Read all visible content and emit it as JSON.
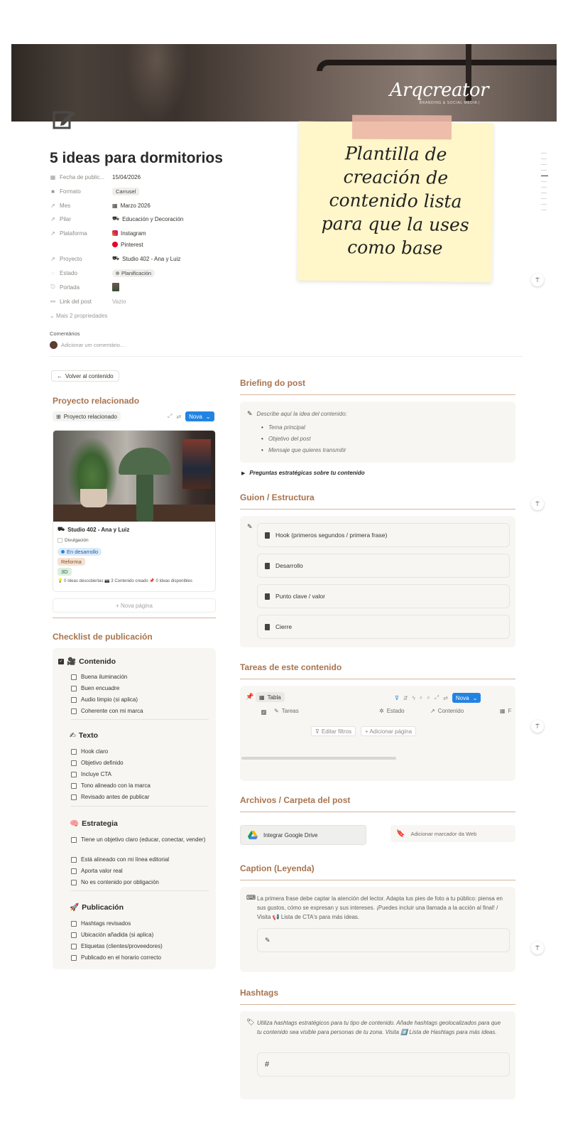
{
  "cover": {
    "brand": "Arqcreator",
    "brand_sub": "BRANDING & SOCIAL MEDIA |"
  },
  "sticky": {
    "text": "Plantilla de\ncreación de\ncontenido lista\npara que la uses\ncomo base"
  },
  "title": "5 ideas para dormitorios",
  "properties": [
    {
      "label": "Fecha de public...",
      "icon": "calendar-icon",
      "glyph": "▦",
      "value": "15/04/2026"
    },
    {
      "label": "Formato",
      "icon": "video-icon",
      "glyph": "■",
      "value": "Carrusel"
    },
    {
      "label": "Mes",
      "icon": "relation-arrow-icon",
      "glyph": "↗",
      "value": "Marzo 2026",
      "value_icon": "▦"
    },
    {
      "label": "Pilar",
      "icon": "relation-arrow-icon",
      "glyph": "↗",
      "value": "Educación y Decoración",
      "value_icon": "⛟"
    },
    {
      "label": "Plataforma",
      "icon": "relation-arrow-icon",
      "glyph": "↗",
      "value": "Instagram",
      "value2": "Pinterest"
    },
    {
      "label": "Proyecto",
      "icon": "relation-arrow-icon",
      "glyph": "↗",
      "value": "Studio 402 - Ana y Luiz",
      "value_icon": "⛟"
    },
    {
      "label": "Estado",
      "icon": "status-icon",
      "glyph": "◌",
      "value": "Planificación"
    },
    {
      "label": "Portada",
      "icon": "attachment-icon",
      "glyph": "⎋",
      "value": ""
    },
    {
      "label": "Link del post",
      "icon": "link-icon",
      "glyph": "⚯",
      "value": "Vazio"
    }
  ],
  "more_props": "Mais 2 propriedades",
  "comments": {
    "label": "Comentários",
    "placeholder": "Adicionar um comentário..."
  },
  "left": {
    "back_button": "Volver al contenido",
    "proyecto_heading": "Proyecto relacionado",
    "view_tab": "Proyecto relacionado",
    "nova_label": "Nova",
    "card": {
      "title": "Studio 402 - Ana y Luiz",
      "checkbox_label": "Divulgación",
      "status": "En desarrollo",
      "tag1": "Reforma",
      "tag2": "3D",
      "stats": "💡 0 Ideas descubiertas 📷 3 Contenido creado 📌 0 Ideas disponibles"
    },
    "nova_pagina": "+ Nova página",
    "checklist_heading": "Checklist de publicación"
  },
  "checklist": [
    {
      "head": "Contenido",
      "emoji": "🎥",
      "items": [
        "Buena iluminación",
        "Buen encuadre",
        "Audio limpio (si aplica)",
        "Coherente con mi marca"
      ]
    },
    {
      "head": "Texto",
      "emoji": "✍",
      "items": [
        "Hook claro",
        "Objetivo definido",
        "Incluye CTA",
        "Tono alineado con la marca",
        "Revisado antes de publicar"
      ]
    },
    {
      "head": "Estrategia",
      "emoji": "🧠",
      "items": [
        "Tiene un objetivo claro (educar, conectar, vender)",
        "Está alineado con mi línea editorial",
        "Aporta valor real",
        "No es contenido por obligación"
      ]
    },
    {
      "head": "Publicación",
      "emoji": "🚀",
      "items": [
        "Hashtags revisados",
        "Ubicación añadida (si aplica)",
        "Etiquetas (clientes/proveedores)",
        "Publicado en el horario correcto"
      ]
    }
  ],
  "right": {
    "briefing_heading": "Briefing do post",
    "briefing_intro": "Describe aquí la idea del contenido:",
    "briefing_bullets": [
      "Tema principal",
      "Objetivo del post",
      "Mensaje que quieres transmitir"
    ],
    "toggle": "Preguntas estratégicas sobre tu contenido",
    "guion_heading": "Guion / Estructura",
    "guion_items": [
      "Hook (primeros segundos / primera frase)",
      "Desarrollo",
      "Punto clave / valor",
      "Cierre"
    ],
    "tareas_heading": "Tareas de este contenido",
    "tareas_view": "Tabla",
    "tareas_cols": [
      "Tareas",
      "Estado",
      "Contenido",
      "F"
    ],
    "editar_filtros": "Editar filtros",
    "adicionar_pagina": "+ Adicionar página",
    "archivos_heading": "Archivos / Carpeta del post",
    "gdrive": "Integrar Google Drive",
    "bookmark": "Adicionar marcador da Web",
    "caption_heading": "Caption (Leyenda)",
    "caption_text": "La primera frase debe captar la atención del lector. Adapta tus pies de foto a tu público: piensa en sus gustos, cómo se expresan y sus intereses. ¡Puedes incluir una llamada a la acción al final! / Visita 📢 Lista de CTA's para más ideas.",
    "hashtags_heading": "Hashtags",
    "hashtags_text": "Utiliza hashtags estratégicos para tu tipo de contenido. Añade hashtags geolocalizados para que tu contenido sea visible para personas de tu zona. Visita #️⃣ Lista de Hashtags para más ideas.",
    "hashtag_symbol": "#"
  },
  "colors": {
    "accent": "#a8744f",
    "nova": "#2383e2",
    "sticky": "#fff6c9"
  }
}
